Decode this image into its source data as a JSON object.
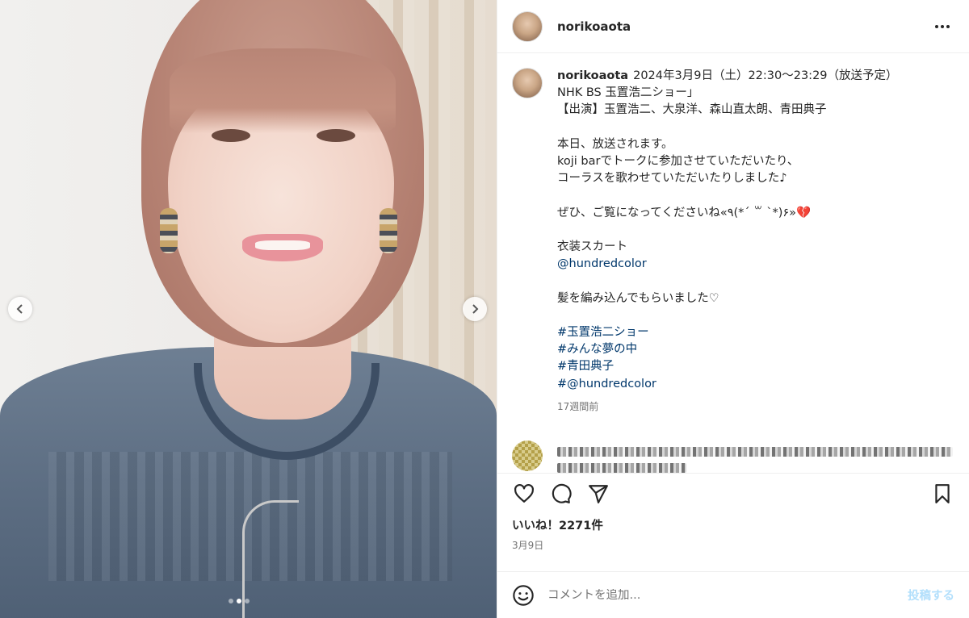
{
  "header": {
    "username": "norikoaota",
    "more_icon": "more-horizontal-icon"
  },
  "caption": {
    "username": "norikoaota",
    "lines": [
      "2024年3月9日（土）22:30～23:29（放送予定）",
      "NHK BS 玉置浩二ショー」",
      "【出演】玉置浩二、大泉洋、森山直太朗、青田典子",
      "",
      "本日、放送されます。",
      "koji barでトークに参加させていただいたり、",
      "コーラスを歌わせていただいたりしました♪",
      "",
      "ぜひ、ご覧になってくださいね«٩(*´ ꒳ `*)۶»💔",
      "",
      "衣装スカート"
    ],
    "mention": "@hundredcolor",
    "after_mention": "髪を編み込んでもらいました♡",
    "hashtags": [
      "#玉置浩二ショー",
      "#みんな夢の中",
      "#青田典子",
      "#@hundredcolor"
    ],
    "time_ago": "17週間前"
  },
  "actions": {
    "like_icon": "heart-icon",
    "comment_icon": "comment-icon",
    "share_icon": "share-icon",
    "save_icon": "bookmark-icon"
  },
  "likes": "いいね！2271件",
  "post_date": "3月9日",
  "comment_box": {
    "placeholder": "コメントを追加...",
    "post_label": "投稿する",
    "emoji_icon": "smiley-icon"
  },
  "media": {
    "prev_icon": "chevron-left-icon",
    "next_icon": "chevron-right-icon",
    "slides": 3,
    "current_slide": 2
  }
}
